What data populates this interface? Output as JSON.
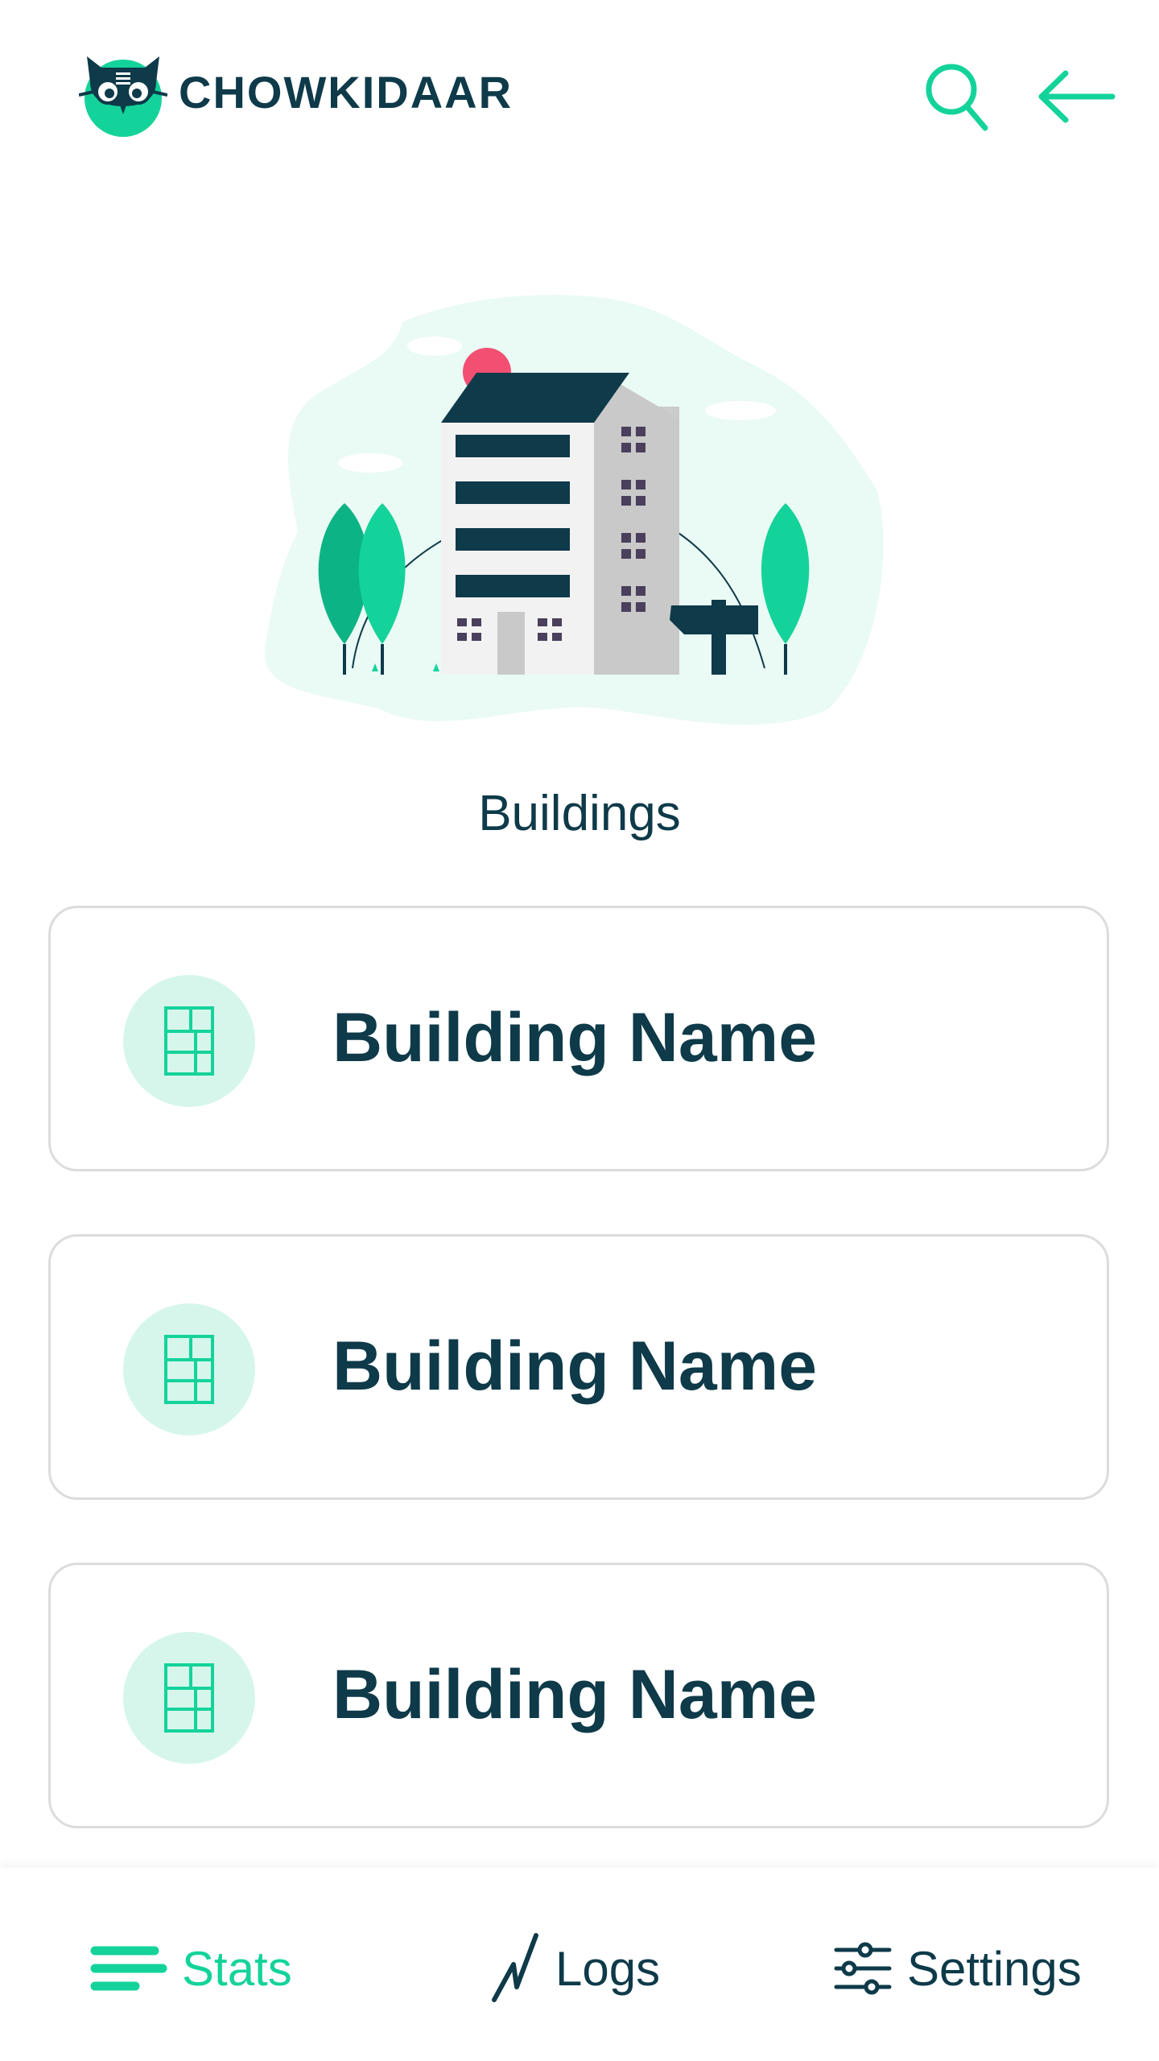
{
  "header": {
    "brand": "CHOWKIDAAR",
    "search_icon": "search-icon",
    "back_icon": "arrow-left-icon"
  },
  "hero": {
    "icon": "building-illustration"
  },
  "section": {
    "title": "Buildings"
  },
  "buildings": [
    {
      "name": "Building Name",
      "icon": "floor-plan-icon"
    },
    {
      "name": "Building Name",
      "icon": "floor-plan-icon"
    },
    {
      "name": "Building Name",
      "icon": "floor-plan-icon"
    }
  ],
  "bottom_nav": {
    "items": [
      {
        "label": "Stats",
        "icon": "stats-bars-icon",
        "active": true
      },
      {
        "label": "Logs",
        "icon": "pulse-line-icon",
        "active": false
      },
      {
        "label": "Settings",
        "icon": "sliders-icon",
        "active": false
      }
    ]
  },
  "colors": {
    "primary": "#14d39a",
    "dark": "#0e3a49",
    "icon_bg": "#d6f6ec",
    "card_border": "#dcdcdc"
  }
}
